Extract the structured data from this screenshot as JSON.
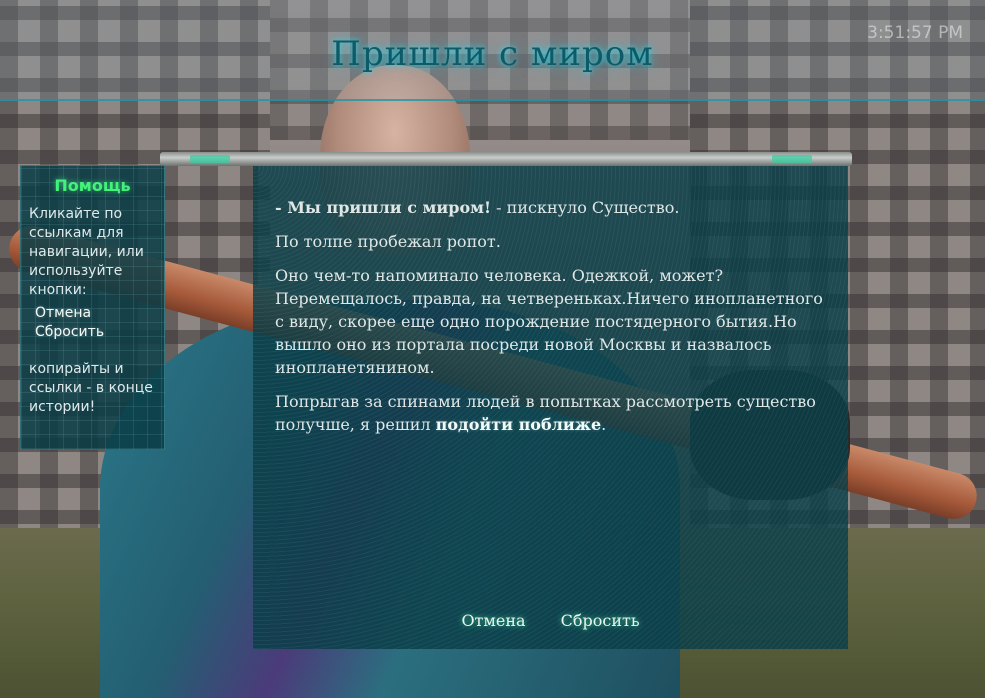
{
  "header": {
    "title": "Пришли с миром",
    "clock": "3:51:57 PM"
  },
  "sidebar": {
    "title": "Помощь",
    "intro": "Кликайте по ссылкам для навигации, или используйте кнопки:",
    "links": [
      "Отмена",
      "Сбросить"
    ],
    "note": "копирайты и ссылки - в конце истории!"
  },
  "story": {
    "p1_speech": "- Мы пришли с миром!",
    "p1_rest": " - пискнуло Существо.",
    "p2": "По толпе пробежал ропот.",
    "p3": "Оно чем-то напоминало человека. Одежкой, может? Перемещалось, правда, на четвереньках.Ничего инопланетного с виду, скорее еще одно порождение постядерного бытия.Но вышло оно из портала посреди новой Москвы и назвалось инопланетянином.",
    "p4_start": "Попрыгав за спинами людей в попытках рассмотреть существо получше, я решил ",
    "p4_link": "подойти поближе",
    "p4_end": "."
  },
  "actions": {
    "undo": "Отмена",
    "reset": "Сбросить"
  },
  "colors": {
    "accent": "#43f27a",
    "title_glow": "#28dcf0",
    "panel_bg": "#0a3e48"
  }
}
